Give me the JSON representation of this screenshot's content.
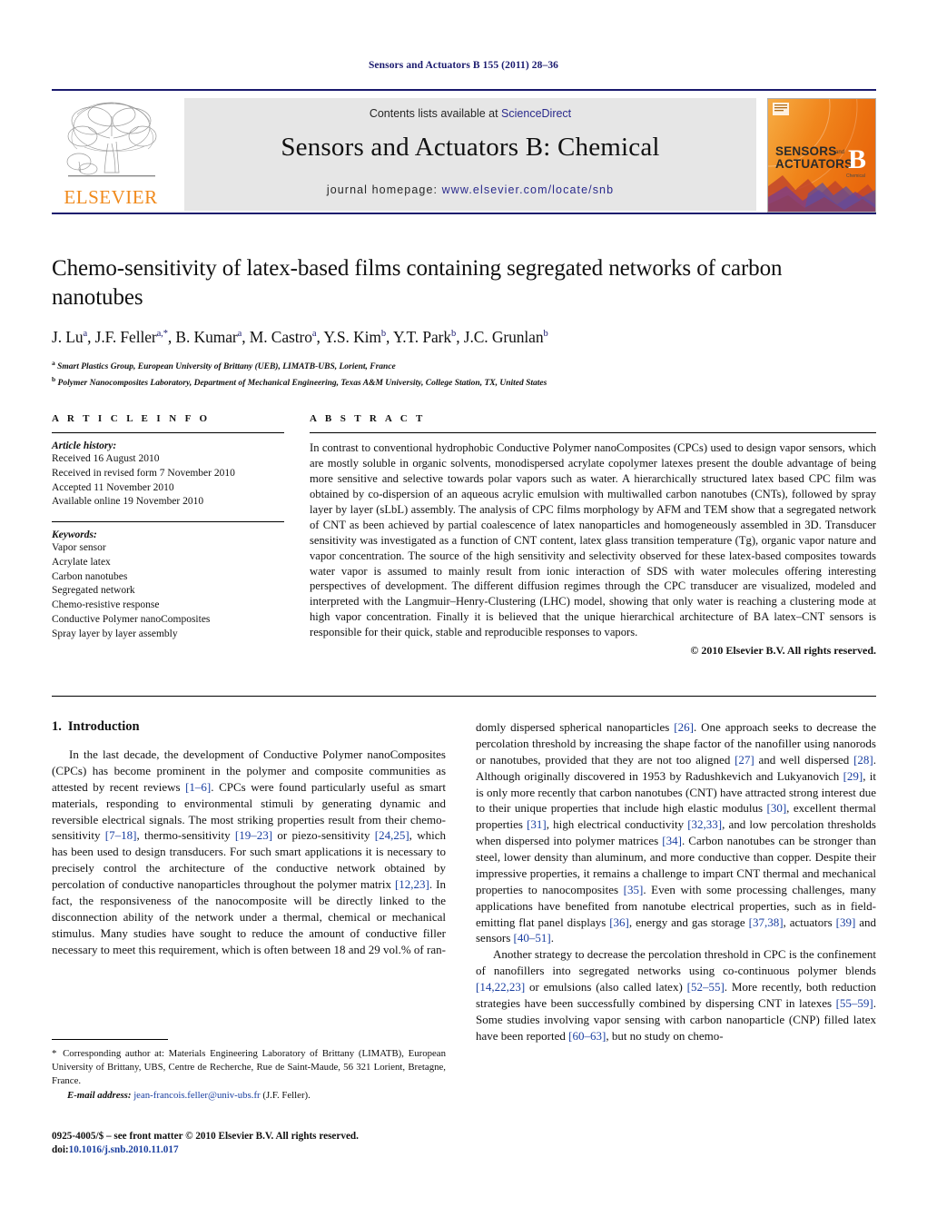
{
  "running_head": "Sensors and Actuators B 155 (2011) 28–36",
  "masthead": {
    "contents_prefix": "Contents lists available at ",
    "sciencedirect": "ScienceDirect",
    "journal_title": "Sensors and Actuators B: Chemical",
    "homepage_prefix": "journal homepage: ",
    "homepage_url": "www.elsevier.com/locate/snb",
    "publisher_name": "ELSEVIER",
    "publisher_logo_alt": "elsevier-tree-logo",
    "cover_line1": "SENSORS",
    "cover_and": "and",
    "cover_line2": "ACTUATORS",
    "cover_letter": "B",
    "cover_sub": "Chemical",
    "accent_orange": "#f08a1c",
    "accent_blue": "#2a2a8c"
  },
  "article": {
    "title": "Chemo-sensitivity of latex-based films containing segregated networks of carbon nanotubes",
    "authors_html": "J. Lu<sup>a</sup>, J.F. Feller<sup>a,*</sup>, B. Kumar<sup>a</sup>, M. Castro<sup>a</sup>, Y.S. Kim<sup>b</sup>, Y.T. Park<sup>b</sup>, J.C. Grunlan<sup>b</sup>",
    "affiliation_a": "Smart Plastics Group, European University of Brittany (UEB), LIMATB-UBS, Lorient, France",
    "affiliation_b": "Polymer Nanocomposites Laboratory, Department of Mechanical Engineering, Texas A&M University, College Station, TX, United States"
  },
  "info": {
    "heading": "A R T I C L E   I N F O",
    "history_label": "Article history:",
    "history": [
      "Received 16 August 2010",
      "Received in revised form 7 November 2010",
      "Accepted 11 November 2010",
      "Available online 19 November 2010"
    ],
    "keywords_label": "Keywords:",
    "keywords": [
      "Vapor sensor",
      "Acrylate latex",
      "Carbon nanotubes",
      "Segregated network",
      "Chemo-resistive response",
      "Conductive Polymer nanoComposites",
      "Spray layer by layer assembly"
    ]
  },
  "abstract": {
    "heading": "A B S T R A C T",
    "text": "In contrast to conventional hydrophobic Conductive Polymer nanoComposites (CPCs) used to design vapor sensors, which are mostly soluble in organic solvents, monodispersed acrylate copolymer latexes present the double advantage of being more sensitive and selective towards polar vapors such as water. A hierarchically structured latex based CPC film was obtained by co-dispersion of an aqueous acrylic emulsion with multiwalled carbon nanotubes (CNTs), followed by spray layer by layer (sLbL) assembly. The analysis of CPC films morphology by AFM and TEM show that a segregated network of CNT as been achieved by partial coalescence of latex nanoparticles and homogeneously assembled in 3D. Transducer sensitivity was investigated as a function of CNT content, latex glass transition temperature (Tg), organic vapor nature and vapor concentration. The source of the high sensitivity and selectivity observed for these latex-based composites towards water vapor is assumed to mainly result from ionic interaction of SDS with water molecules offering interesting perspectives of development. The different diffusion regimes through the CPC transducer are visualized, modeled and interpreted with the Langmuir–Henry-Clustering (LHC) model, showing that only water is reaching a clustering mode at high vapor concentration. Finally it is believed that the unique hierarchical architecture of BA latex–CNT sensors is responsible for their quick, stable and reproducible responses to vapors.",
    "copyright": "© 2010 Elsevier B.V. All rights reserved."
  },
  "body": {
    "section_number": "1.",
    "section_title": "Introduction",
    "left_paragraph_html": "In the last decade, the development of Conductive Polymer nanoComposites (CPCs) has become prominent in the polymer and composite communities as attested by recent reviews <span class=\"ref\">[1–6]</span>. CPCs were found particularly useful as smart materials, responding to environmental stimuli by generating dynamic and reversible electrical signals. The most striking properties result from their chemo-sensitivity <span class=\"ref\">[7–18]</span>, thermo-sensitivity <span class=\"ref\">[19–23]</span> or piezo-sensitivity <span class=\"ref\">[24,25]</span>, which has been used to design transducers. For such smart applications it is necessary to precisely control the architecture of the conductive network obtained by percolation of conductive nanoparticles throughout the polymer matrix <span class=\"ref\">[12,23]</span>. In fact, the responsiveness of the nanocomposite will be directly linked to the disconnection ability of the network under a thermal, chemical or mechanical stimulus. Many studies have sought to reduce the amount of conductive filler necessary to meet this requirement, which is often between 18 and 29 vol.% of ran-",
    "right_paragraph1_html": "domly dispersed spherical nanoparticles <span class=\"ref\">[26]</span>. One approach seeks to decrease the percolation threshold by increasing the shape factor of the nanofiller using nanorods or nanotubes, provided that they are not too aligned <span class=\"ref\">[27]</span> and well dispersed <span class=\"ref\">[28]</span>. Although originally discovered in 1953 by Radushkevich and Lukyanovich <span class=\"ref\">[29]</span>, it is only more recently that carbon nanotubes (CNT) have attracted strong interest due to their unique properties that include high elastic modulus <span class=\"ref\">[30]</span>, excellent thermal properties <span class=\"ref\">[31]</span>, high electrical conductivity <span class=\"ref\">[32,33]</span>, and low percolation thresholds when dispersed into polymer matrices <span class=\"ref\">[34]</span>. Carbon nanotubes can be stronger than steel, lower density than aluminum, and more conductive than copper. Despite their impressive properties, it remains a challenge to impart CNT thermal and mechanical properties to nanocomposites <span class=\"ref\">[35]</span>. Even with some processing challenges, many applications have benefited from nanotube electrical properties, such as in field-emitting flat panel displays <span class=\"ref\">[36]</span>, energy and gas storage <span class=\"ref\">[37,38]</span>, actuators <span class=\"ref\">[39]</span> and sensors <span class=\"ref\">[40–51]</span>.",
    "right_paragraph2_html": "Another strategy to decrease the percolation threshold in CPC is the confinement of nanofillers into segregated networks using co-continuous polymer blends <span class=\"ref\">[14,22,23]</span> or emulsions (also called latex) <span class=\"ref\">[52–55]</span>. More recently, both reduction strategies have been successfully combined by dispersing CNT in latexes <span class=\"ref\">[55–59]</span>. Some studies involving vapor sensing with carbon nanoparticle (CNP) filled latex have been reported <span class=\"ref\">[60–63]</span>, but no study on chemo-"
  },
  "footnotes": {
    "corresponding_html": "<span class=\"star\">*</span> Corresponding author at: Materials Engineering Laboratory of Brittany (LIMATB), European University of Brittany, UBS, Centre de Recherche, Rue de Saint-Maude, 56 321 Lorient, Bretagne, France.",
    "email_label": "E-mail address:",
    "email": "jean-francois.feller@univ-ubs.fr",
    "email_suffix": "(J.F. Feller).",
    "issn_line": "0925-4005/$ – see front matter © 2010 Elsevier B.V. All rights reserved.",
    "doi_label": "doi:",
    "doi": "10.1016/j.snb.2010.11.017"
  }
}
